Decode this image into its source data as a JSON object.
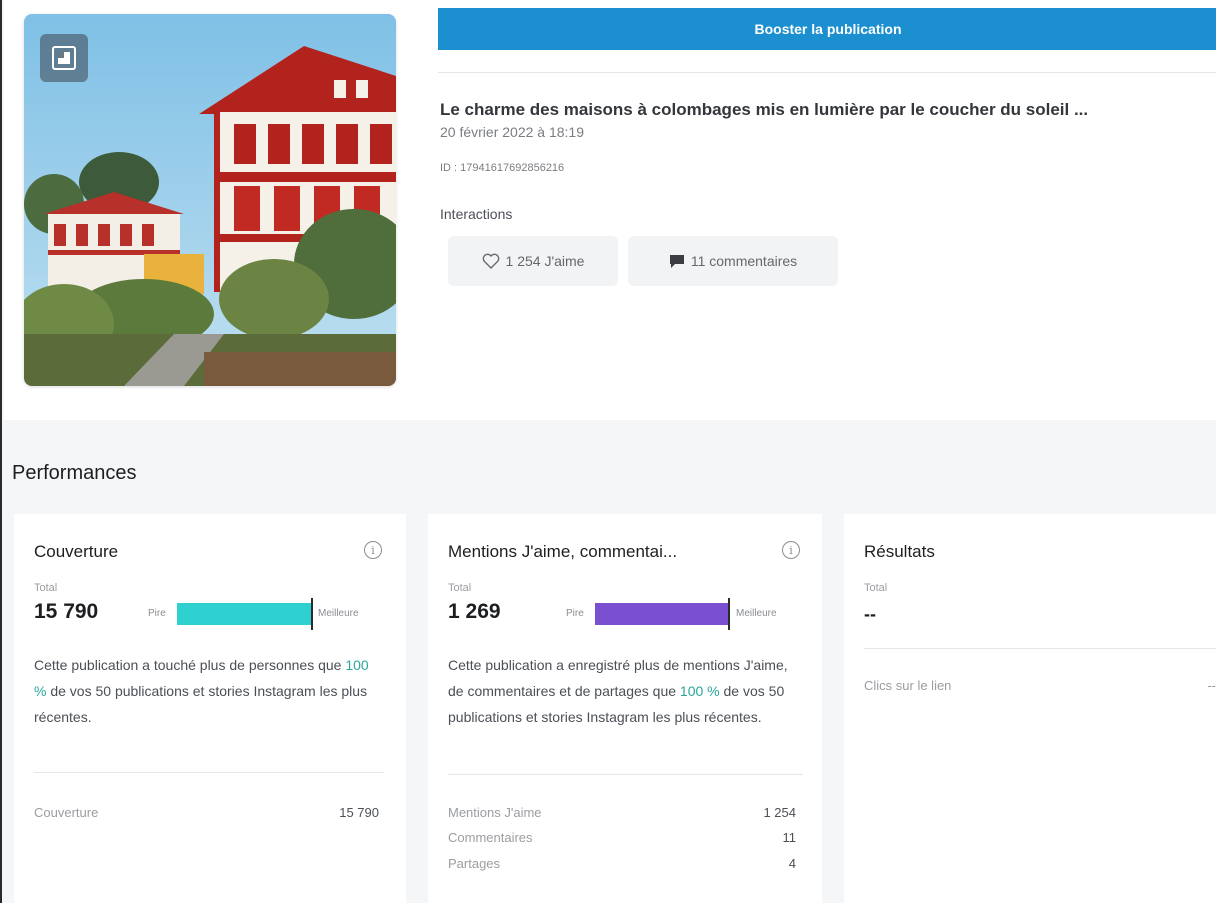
{
  "boost_button": "Booster la publication",
  "post": {
    "title": "Le charme des maisons à colombages mis en lumière par le coucher du soleil ...",
    "date": "20 février 2022 à 18:19",
    "id": "ID : 17941617692856216",
    "interactions_label": "Interactions",
    "likes_chip": "1 254 J'aime",
    "comments_chip": "11 commentaires"
  },
  "performances": {
    "title": "Performances",
    "reach": {
      "title": "Couverture",
      "total_label": "Total",
      "total_value": "15 790",
      "scale_low": "Pire",
      "scale_high": "Meilleure",
      "bar_color": "#2fd0d0",
      "bar_fill_percent": 100,
      "desc_before": "Cette publication a touché plus de personnes que ",
      "desc_pct": "100 %",
      "desc_after": " de vos 50 publications et stories Instagram les plus récentes.",
      "rows": [
        {
          "label": "Couverture",
          "value": "15 790"
        }
      ]
    },
    "engagement": {
      "title": "Mentions J'aime, commentai...",
      "total_label": "Total",
      "total_value": "1 269",
      "scale_low": "Pire",
      "scale_high": "Meilleure",
      "bar_color": "#7a4fd0",
      "bar_fill_percent": 100,
      "desc_before": "Cette publication a enregistré plus de mentions J'aime, de commentaires et de partages que ",
      "desc_pct": "100 %",
      "desc_after": " de vos 50 publications et stories Instagram les plus récentes.",
      "rows": [
        {
          "label": "Mentions J'aime",
          "value": "1 254"
        },
        {
          "label": "Commentaires",
          "value": "11"
        },
        {
          "label": "Partages",
          "value": "4"
        }
      ]
    },
    "results": {
      "title": "Résultats",
      "total_label": "Total",
      "total_value": "--",
      "rows": [
        {
          "label": "Clics sur le lien",
          "value": "--"
        }
      ]
    }
  }
}
